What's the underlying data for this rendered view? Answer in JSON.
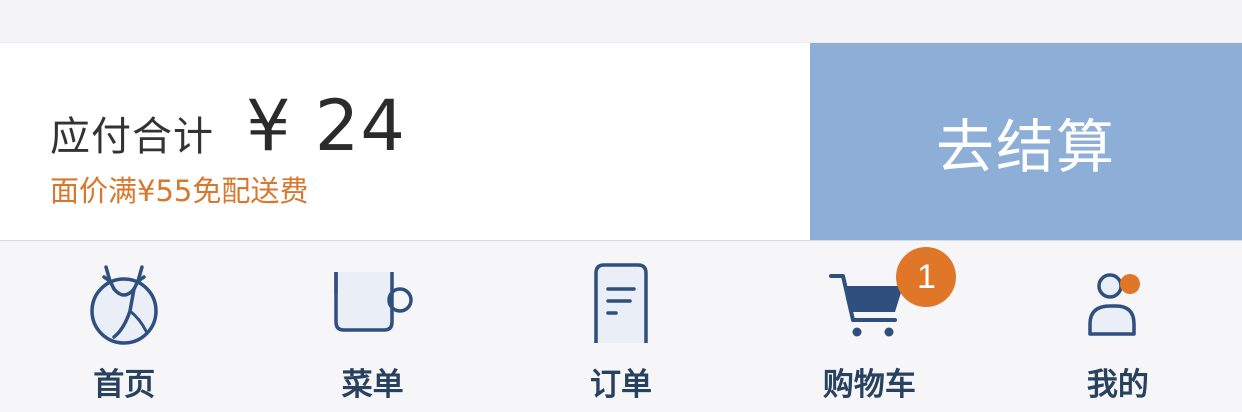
{
  "checkout": {
    "total_label": "应付合计",
    "total_amount": "¥ 24",
    "delivery_note": "面价满¥55免配送费",
    "checkout_label": "去结算"
  },
  "tabs": [
    {
      "label": "首页",
      "icon": "deer-globe-icon"
    },
    {
      "label": "菜单",
      "icon": "cup-icon"
    },
    {
      "label": "订单",
      "icon": "receipt-icon"
    },
    {
      "label": "购物车",
      "icon": "cart-icon",
      "badge": "1"
    },
    {
      "label": "我的",
      "icon": "user-icon"
    }
  ],
  "colors": {
    "accent_button": "#8daed6",
    "badge": "#e07627",
    "note": "#d8772e",
    "nav_text": "#27415f",
    "icon_stroke": "#2f4f7f"
  }
}
